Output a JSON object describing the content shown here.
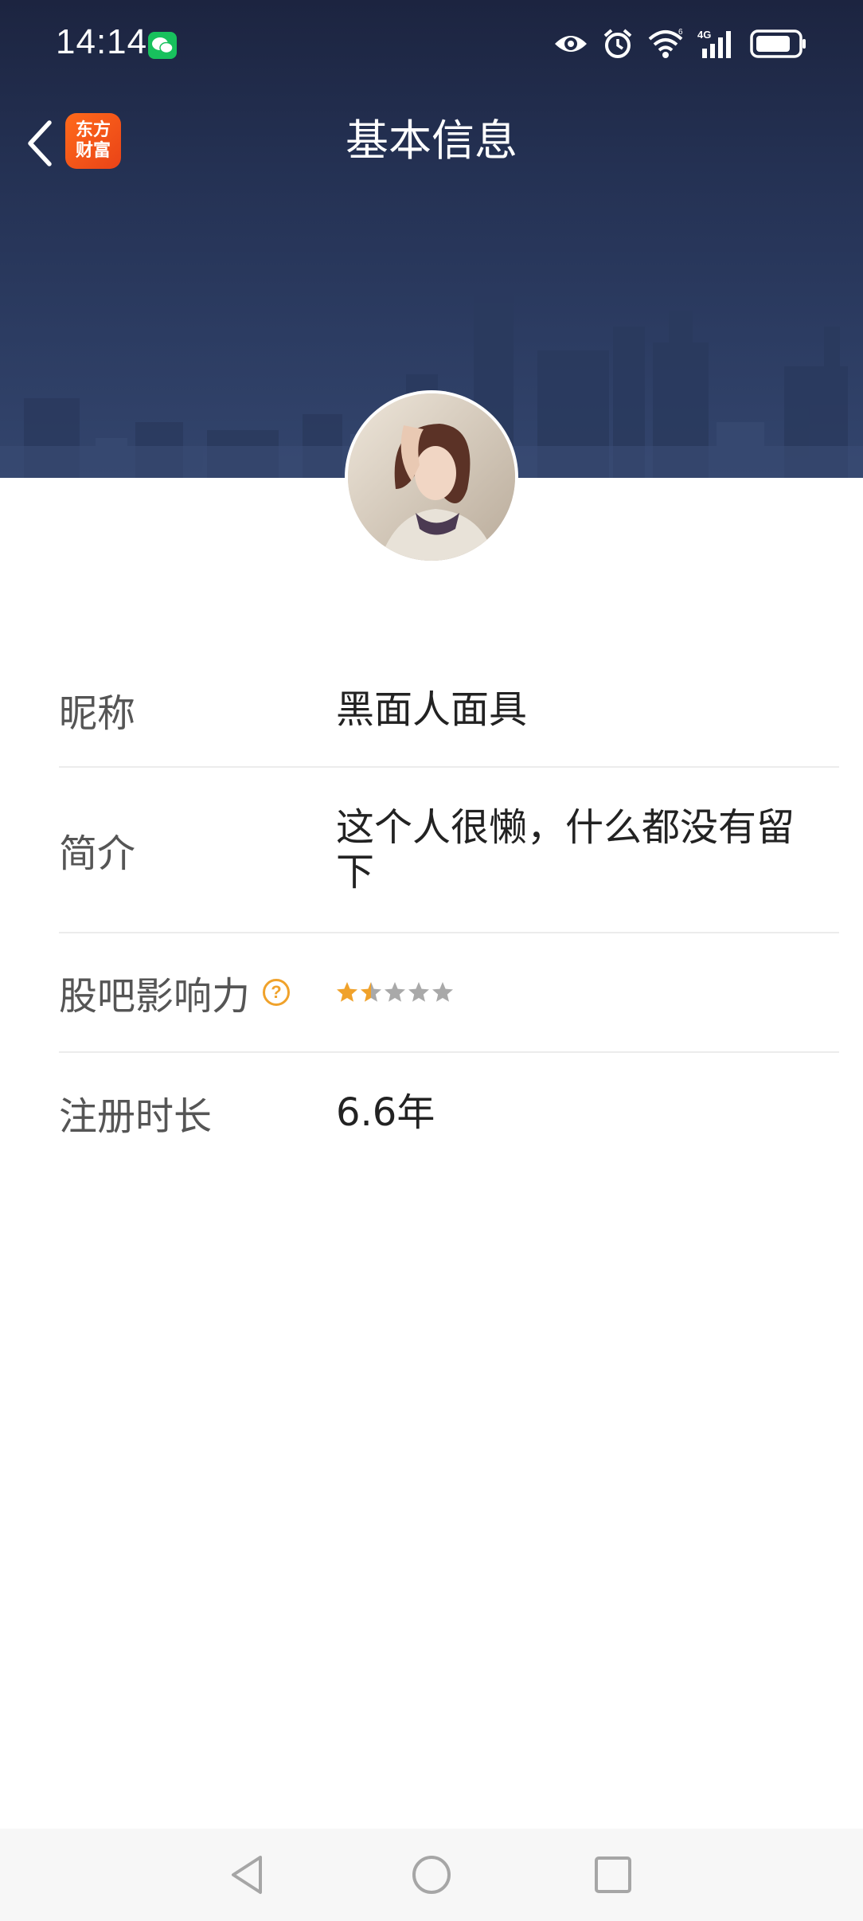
{
  "status_bar": {
    "time": "14:14",
    "icons": [
      "wechat-icon",
      "eye-icon",
      "alarm-icon",
      "wifi-icon",
      "signal-4g-icon",
      "battery-icon"
    ]
  },
  "header": {
    "title": "基本信息",
    "logo_line1": "东方",
    "logo_line2": "财富",
    "accent_color": "#ff5a1a"
  },
  "profile": {
    "rows": [
      {
        "label": "昵称",
        "value": "黑面人面具"
      },
      {
        "label": "简介",
        "value": "这个人很懒，什么都没有留下"
      },
      {
        "label": "股吧影响力",
        "rating": 1.5,
        "rating_max": 5,
        "help": "?"
      },
      {
        "label": "注册时长",
        "value": "6.6年"
      }
    ]
  },
  "nav_bar": {
    "buttons": [
      "back-triangle-icon",
      "home-circle-icon",
      "recents-square-icon"
    ]
  },
  "colors": {
    "star_active": "#f0a22b",
    "star_inactive": "#a9a9a9"
  }
}
